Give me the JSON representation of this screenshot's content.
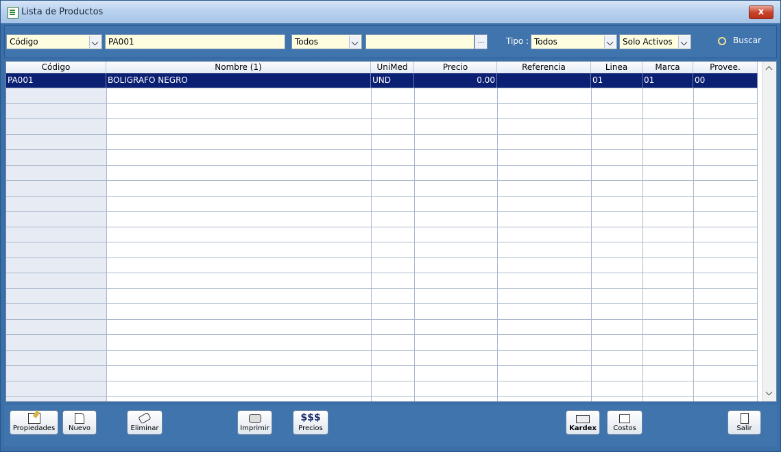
{
  "window": {
    "title": "Lista de Productos",
    "close_label": "x"
  },
  "filters": {
    "field_combo": "Código",
    "search_value": "PA001",
    "scope_combo": "Todos",
    "extra_value": "",
    "ellipsis_label": "...",
    "tipo_label": "Tipo :",
    "tipo_combo": "Todos",
    "status_combo": "Solo Activos",
    "search_label": "Buscar"
  },
  "table": {
    "columns": [
      "Código",
      "Nombre (1)",
      "UniMed",
      "Precio",
      "Referencia",
      "Linea",
      "Marca",
      "Provee."
    ],
    "rows": [
      [
        "PA001",
        "BOLIGRAFO NEGRO",
        "UND",
        "0.00",
        "",
        "01",
        "01",
        "00"
      ]
    ]
  },
  "toolbar": {
    "propiedades": "Propiedades",
    "nuevo": "Nuevo",
    "eliminar": "Eliminar",
    "imprimir": "Imprimir",
    "precios_icon": "$$$",
    "precios": "Precios",
    "kardex": "Kardex",
    "costos": "Costos",
    "salir": "Salir"
  },
  "colors": {
    "window_bg": "#3b6fa8",
    "selection": "#0b1f73",
    "input_bg": "#fffde0"
  }
}
